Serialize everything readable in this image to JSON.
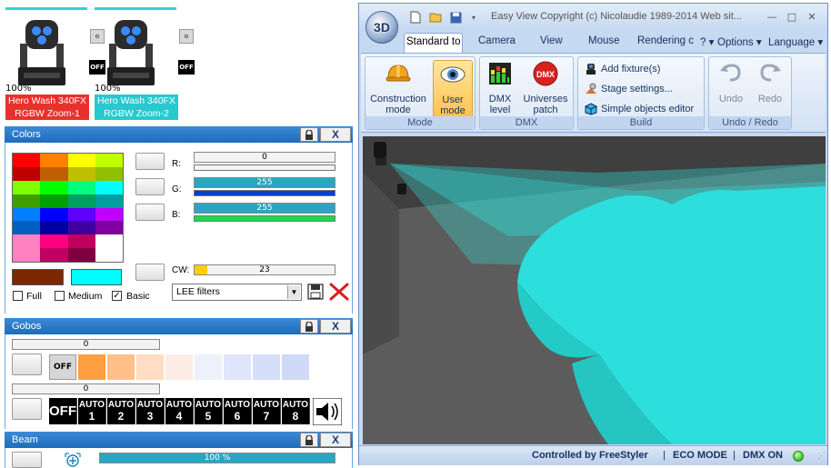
{
  "fixtures": [
    {
      "percent": "100%",
      "name": "Hero Wash 340FX",
      "mode": "RGBW Zoom-1",
      "label_color": "#e8312d",
      "bar_color": "#2ad7d7",
      "off_label": "OFF"
    },
    {
      "percent": "100%",
      "name": "Hero Wash 340FX",
      "mode": "RGBW Zoom-2",
      "label_color": "#27c9cf",
      "bar_color": "#2ad7d7",
      "off_label": "OFF"
    }
  ],
  "colors_panel": {
    "title": "Colors",
    "close_label": "X",
    "swatches": [
      "#ff0000",
      "#ff7f00",
      "#ffff00",
      "#bfff00",
      "#bf0000",
      "#bf5f00",
      "#bfbf00",
      "#8fbf00",
      "#7fff00",
      "#00ff00",
      "#00ff7f",
      "#00ffff",
      "#3f9f00",
      "#00a000",
      "#00a05f",
      "#009f9f",
      "#0080ff",
      "#0000ff",
      "#5f00ff",
      "#bf00ff",
      "#005fbf",
      "#0000a0",
      "#40009f",
      "#7f00a0",
      "#ff80c0",
      "#ff0080",
      "#bf0060",
      "#ffffff",
      "#ff80c0",
      "#c00060",
      "#7f0040",
      "#ffffff"
    ],
    "selected_left_color": "#7a2800",
    "selected_right_color": "#00ffff",
    "checkboxes": [
      {
        "label": "Full",
        "checked": false
      },
      {
        "label": "Medium",
        "checked": false
      },
      {
        "label": "Basic",
        "checked": true
      }
    ],
    "channels": [
      {
        "label": "R:",
        "value": "0",
        "percent": 0,
        "bar_color": "#29d3e0"
      },
      {
        "label": "G:",
        "value": "255",
        "percent": 100,
        "bar_color": "#0040d0"
      },
      {
        "label": "B:",
        "value": "255",
        "percent": 100,
        "bar_color": "#1fd64a"
      },
      {
        "label": "CW:",
        "value": "23",
        "percent": 9,
        "bar_color": "#ffd000"
      }
    ],
    "filter_dropdown": "LEE filters"
  },
  "gobos_panel": {
    "title": "Gobos",
    "close_label": "X",
    "value_1": "0",
    "value_2": "0",
    "off_label": "OFF",
    "gobo_colors": [
      "#ff9f40",
      "#ffc08a",
      "#ffdcc2",
      "#fdece6",
      "#eef0fb",
      "#dfe5fa",
      "#d6defa",
      "#cfdaf7"
    ],
    "auto_label": "AUTO",
    "auto_numbers": [
      "1",
      "2",
      "3",
      "4",
      "5",
      "6",
      "7",
      "8"
    ]
  },
  "beam_panel": {
    "title": "Beam",
    "close_label": "X",
    "value": "100 %"
  },
  "window": {
    "title": "Easy View   Copyright (c) Nicolaudie 1989-2014   Web sit...",
    "orb_label": "3D",
    "tabs": [
      "Standard to",
      "Camera",
      "View",
      "Mouse",
      "Rendering c",
      "Options",
      "Language"
    ],
    "help_label": "?",
    "groups": {
      "mode": {
        "label": "Mode",
        "construction": "Construction mode",
        "user": "User mode"
      },
      "dmx": {
        "label": "DMX",
        "level": "DMX level",
        "patch": "Universes patch"
      },
      "build": {
        "label": "Build",
        "add_fixture": "Add fixture(s)",
        "stage_settings": "Stage settings...",
        "objects_editor": "Simple objects editor"
      },
      "undo_redo": {
        "label": "Undo / Redo",
        "undo": "Undo",
        "redo": "Redo"
      }
    },
    "status": {
      "controlled_by": "Controlled by FreeStyler",
      "eco_mode": "ECO MODE",
      "dmx_on": "DMX ON"
    }
  }
}
